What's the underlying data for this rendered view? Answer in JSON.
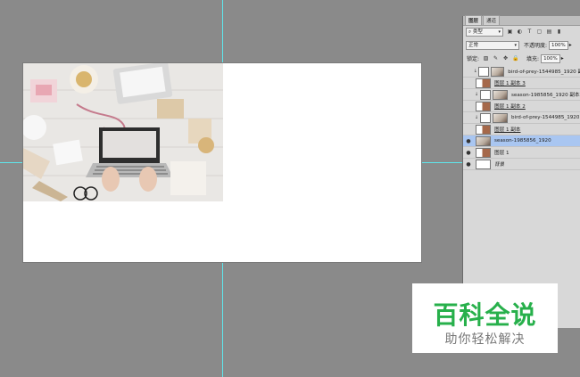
{
  "panel": {
    "tabs": [
      "图层",
      "通道"
    ],
    "filter_kind": "类型",
    "blend_mode": "正常",
    "opacity_label": "不透明度:",
    "opacity_value": "100%",
    "lock_label": "锁定:",
    "fill_label": "填充:",
    "fill_value": "100%",
    "layers": [
      {
        "name": "bird-of-prey-1544985_1920 副本",
        "visible": false,
        "clipped": true,
        "selected": false
      },
      {
        "name": "图层 1 副本 3",
        "visible": false,
        "clipped": false,
        "selected": false
      },
      {
        "name": "season-1985856_1920 副本",
        "visible": false,
        "clipped": true,
        "selected": false
      },
      {
        "name": "图层 1 副本 2",
        "visible": false,
        "clipped": false,
        "selected": false
      },
      {
        "name": "bird-of-prey-1544985_1920",
        "visible": false,
        "clipped": true,
        "selected": false
      },
      {
        "name": "图层 1 副本",
        "visible": false,
        "clipped": false,
        "selected": false
      },
      {
        "name": "season-1985856_1920",
        "visible": true,
        "clipped": false,
        "selected": true
      },
      {
        "name": "图层 1",
        "visible": true,
        "clipped": false,
        "selected": false
      },
      {
        "name": "背景",
        "visible": true,
        "clipped": false,
        "selected": false
      }
    ]
  },
  "watermark": {
    "title": "百科全说",
    "subtitle": "助你轻松解决"
  }
}
